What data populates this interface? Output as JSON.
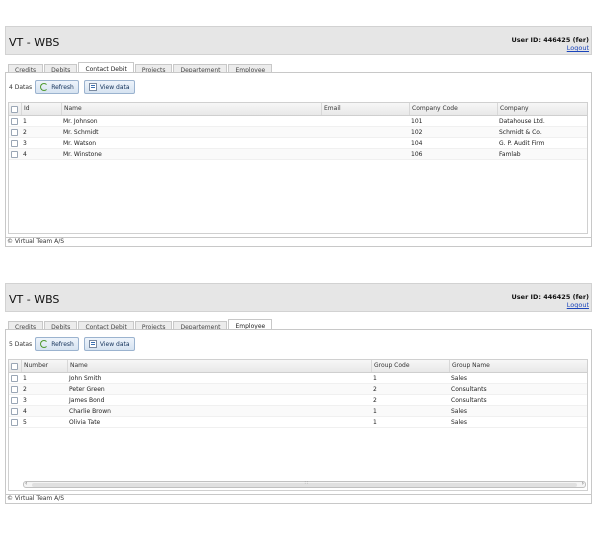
{
  "panels": [
    {
      "app_title": "VT - WBS",
      "user_id": "User ID: 446425 (fer)",
      "logout": "Logout",
      "tabs": [
        "Credits",
        "Debits",
        "Contact Debit",
        "Projects",
        "Departement",
        "Employee"
      ],
      "active_tab": "Contact Debit",
      "count_label": "4 Datas",
      "refresh_label": "Refresh",
      "view_label": "View data",
      "columns": [
        "Id",
        "Name",
        "Email",
        "Company Code",
        "Company"
      ],
      "rows": [
        [
          "1",
          "Mr. Johnson",
          "",
          "101",
          "Datahouse Ltd."
        ],
        [
          "2",
          "Mr. Schmidt",
          "",
          "102",
          "Schmidt & Co."
        ],
        [
          "3",
          "Mr. Watson",
          "",
          "104",
          "G. P. Audit Firm"
        ],
        [
          "4",
          "Mr. Winstone",
          "",
          "106",
          "Famlab"
        ]
      ],
      "footer": "© Virtual Team A/S"
    },
    {
      "app_title": "VT - WBS",
      "user_id": "User ID: 446425 (fer)",
      "logout": "Logout",
      "tabs": [
        "Credits",
        "Debits",
        "Contact Debit",
        "Projects",
        "Departement",
        "Employee"
      ],
      "active_tab": "Employee",
      "count_label": "5 Datas",
      "refresh_label": "Refresh",
      "view_label": "View data",
      "columns": [
        "Number",
        "Name",
        "Group Code",
        "Group Name"
      ],
      "rows": [
        [
          "1",
          "John Smith",
          "1",
          "Sales"
        ],
        [
          "2",
          "Peter Green",
          "2",
          "Consultants"
        ],
        [
          "3",
          "James Bond",
          "2",
          "Consultants"
        ],
        [
          "4",
          "Charlie Brown",
          "1",
          "Sales"
        ],
        [
          "5",
          "Olivia Tate",
          "1",
          "Sales"
        ]
      ],
      "footer": "© Virtual Team A/S"
    }
  ]
}
